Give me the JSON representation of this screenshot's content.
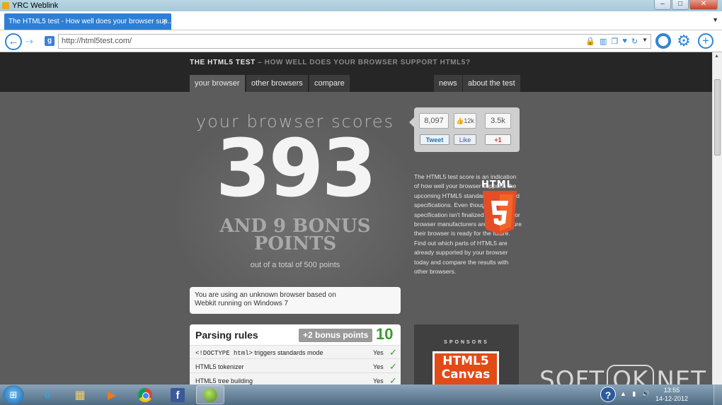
{
  "window": {
    "title": "YRC Weblink",
    "minimize": "–",
    "maximize": "□",
    "close": "✕"
  },
  "tab": {
    "label": "The HTML5 test - How well does your browser sup...",
    "close": "×"
  },
  "nav": {
    "url": "http://html5test.com/",
    "g_badge": "g"
  },
  "site": {
    "title": "THE HTML5 TEST",
    "dash": " – ",
    "subtitle": "HOW WELL DOES YOUR BROWSER SUPPORT HTML5?",
    "tabs": [
      "your browser",
      "other browsers",
      "compare",
      "news",
      "about the test"
    ]
  },
  "score": {
    "heading": "your browser scores",
    "value": "393",
    "bonus_line1": "AND 9 BONUS",
    "bonus_line2": "POINTS",
    "total": "out of a total of 500 points"
  },
  "ua_message_line1": "You are using an unknown browser based on",
  "ua_message_line2": "Webkit running on Windows 7",
  "rules": {
    "title": "Parsing rules",
    "bonus": "+2 bonus points",
    "score": "10",
    "rows": [
      {
        "code": "<!DOCTYPE html>",
        "name": " triggers standards mode",
        "value": "Yes",
        "check": "✓"
      },
      {
        "name": "HTML5 tokenizer",
        "value": "Yes",
        "check": "✓"
      },
      {
        "name": "HTML5 tree building",
        "value": "Yes",
        "check": "✓"
      }
    ]
  },
  "social": {
    "plusone_count": "8,097",
    "like_count": "12k",
    "tweet_count": "3.5k",
    "tweet": "Tweet",
    "like": "Like",
    "plusone": "+1"
  },
  "about": "The HTML5 test score is an indication of how well your browser supports the upcoming HTML5 standard and related specifications. Even though the specification isn't finalized yet, all major browser manufacturers are making sure their browser is ready for the future. Find out which parts of HTML5 are already supported by your browser today and compare the results with other browsers.",
  "html5_logo_label": "HTML",
  "sponsors": {
    "label": "SPONSORS",
    "ad_line1": "HTML5",
    "ad_line2": "Canvas"
  },
  "taskbar": {
    "clock_time": "13:55",
    "clock_date": "14-12-2012"
  },
  "watermark": {
    "left": "SOFT",
    "mid": "OK",
    "right": "NET"
  },
  "colors": {
    "accent": "#2e86d4",
    "html5_orange": "#e44d26",
    "check_green": "#3b9a2f"
  }
}
